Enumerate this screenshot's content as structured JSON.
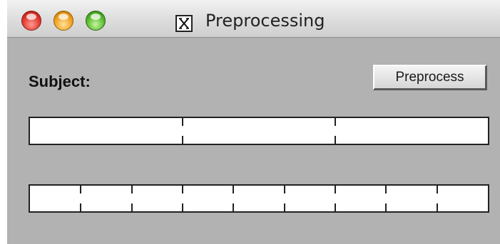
{
  "window": {
    "title": "Preprocessing"
  },
  "icons": {
    "app_icon": "x11-icon"
  },
  "form": {
    "subject_label": "Subject:",
    "preprocess_button": "Preprocess"
  },
  "bars": {
    "top_divisions": 3,
    "bottom_divisions": 9
  },
  "colors": {
    "window_bg": "#b2b2b2",
    "bar_fill": "#ffffff",
    "close": "#e0372e",
    "minimize": "#f0a020",
    "zoom": "#57b92e"
  }
}
